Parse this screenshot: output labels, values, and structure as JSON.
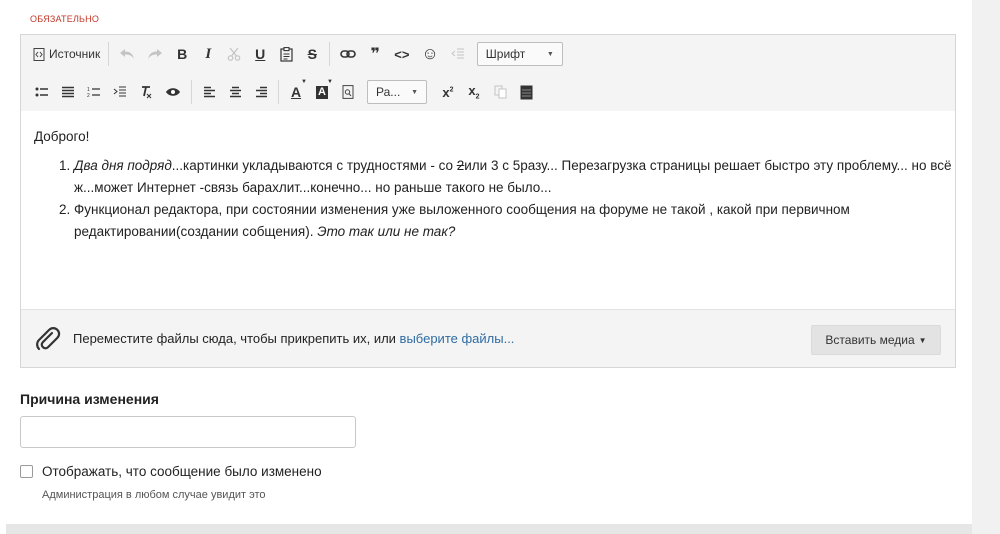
{
  "required_label": "ОБЯЗАТЕЛЬНО",
  "toolbar": {
    "row1": [
      {
        "icon": "source-icon",
        "label": "Источник"
      },
      {
        "icon": "undo-icon",
        "disabled": true
      },
      {
        "icon": "redo-icon",
        "disabled": true
      },
      {
        "icon": "bold-icon",
        "glyph": "B"
      },
      {
        "icon": "italic-icon",
        "glyph": "I"
      },
      {
        "icon": "cut-icon",
        "disabled": true
      },
      {
        "icon": "underline-icon",
        "glyph": "U"
      },
      {
        "icon": "paste-icon"
      },
      {
        "icon": "strikethrough-icon",
        "glyph": "S"
      },
      {
        "icon": "link-icon"
      },
      {
        "icon": "blockquote-icon",
        "glyph": "❞"
      },
      {
        "icon": "code-icon",
        "glyph": "<>"
      },
      {
        "icon": "smiley-icon",
        "glyph": "☺"
      },
      {
        "icon": "outdent-icon",
        "disabled": true
      }
    ],
    "font_combo": "Шрифт",
    "row2": [
      {
        "icon": "bulleted-list-icon"
      },
      {
        "icon": "justify-icon"
      },
      {
        "icon": "numbered-list-icon"
      },
      {
        "icon": "indent-icon"
      },
      {
        "icon": "remove-format-icon"
      },
      {
        "icon": "preview-eye-icon"
      },
      {
        "icon": "align-left-icon"
      },
      {
        "icon": "align-center-icon"
      },
      {
        "icon": "align-right-icon"
      },
      {
        "icon": "text-color-icon",
        "glyph": "A"
      },
      {
        "icon": "background-color-icon",
        "glyph": "A"
      },
      {
        "icon": "find-icon"
      }
    ],
    "size_combo": "Ра...",
    "row2_tail": [
      {
        "icon": "superscript-icon"
      },
      {
        "icon": "subscript-icon"
      },
      {
        "icon": "copy-icon",
        "disabled": true
      },
      {
        "icon": "spoiler-block-icon"
      }
    ]
  },
  "content": {
    "greeting": "Доброго!",
    "item1_italic": "Два дня подряд",
    "item1_a": "...картинки укладываются с трудностями - со ",
    "item1_strike": "2",
    "item1_b": "или 3 с 5разу... Перезагрузка страницы решает быстро эту проблему... но всё ж...может Интернет -связь барахлит...конечно... но раньше такого не было...",
    "item2_a": "Функционал редактора, при состоянии изменения уже выложенного сообщения на форуме  не такой , какой при первичном редактировании(создании собщения). ",
    "item2_italic": "Это так или не так?"
  },
  "dropzone": {
    "text": "Переместите файлы сюда, чтобы прикрепить их, или ",
    "link": "выберите файлы...",
    "insert_media": "Вставить медиа"
  },
  "reason": {
    "title": "Причина изменения",
    "value": "",
    "placeholder": ""
  },
  "edited_checkbox": {
    "checked": false,
    "label": "Отображать, что сообщение было изменено",
    "hint": "Администрация в любом случае увидит это"
  }
}
